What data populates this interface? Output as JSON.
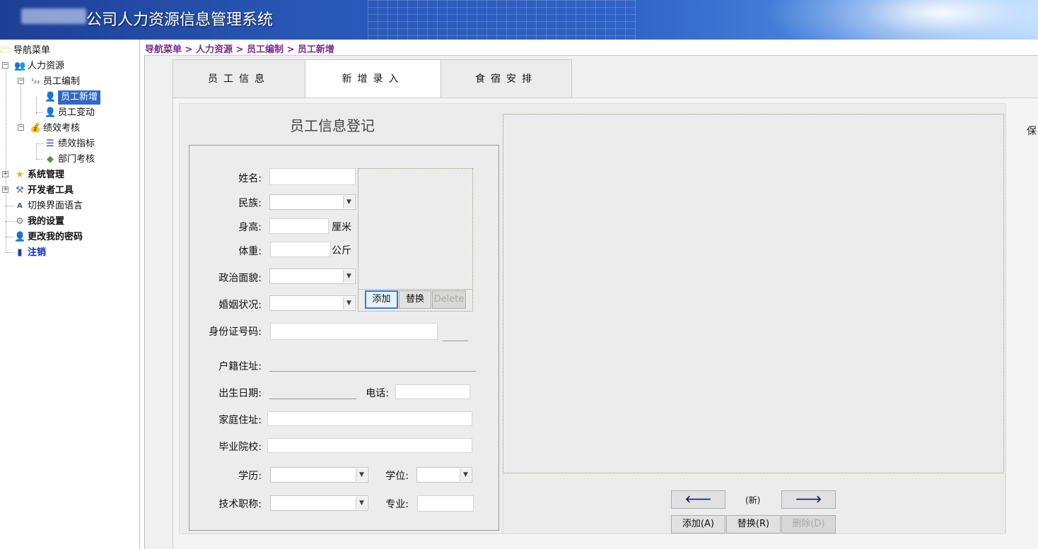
{
  "header": {
    "title": "公司人力资源信息管理系统"
  },
  "nav": {
    "root": "导航菜单",
    "items": [
      {
        "label": "人力资源"
      },
      {
        "label": "员工编制"
      },
      {
        "label": "员工新增"
      },
      {
        "label": "员工变动"
      },
      {
        "label": "绩效考核"
      },
      {
        "label": "绩效指标"
      },
      {
        "label": "部门考核"
      },
      {
        "label": "系统管理"
      },
      {
        "label": "开发者工具"
      },
      {
        "label": "切换界面语言"
      },
      {
        "label": "我的设置"
      },
      {
        "label": "更改我的密码"
      },
      {
        "label": "注销"
      }
    ],
    "num_icon_text": "¹₂₃"
  },
  "breadcrumb": {
    "sep": " > ",
    "parts": [
      "导航菜单",
      "人力资源",
      "员工编制",
      "员工新增"
    ]
  },
  "tabs": [
    "员工信息",
    "新增录入",
    "食宿安排"
  ],
  "form": {
    "title": "员工信息登记",
    "name_label": "姓名:",
    "ethnicity_label": "民族:",
    "height_label": "身高:",
    "height_unit": "厘米",
    "weight_label": "体重:",
    "weight_unit": "公斤",
    "political_label": "政治面貌:",
    "marital_label": "婚姻状况:",
    "idcard_label": "身份证号码:",
    "domicile_label": "户籍住址:",
    "birth_label": "出生日期:",
    "phone_label": "电话:",
    "home_label": "家庭住址:",
    "school_label": "毕业院校:",
    "education_label": "学历:",
    "degree_label": "学位:",
    "title_label": "技术职称:",
    "major_label": "专业:"
  },
  "photo": {
    "add": "添加",
    "replace": "替换",
    "delete": "Delete"
  },
  "preview": {
    "prev_arrow": "🡐",
    "next_arrow": "🡒",
    "status": "(新)",
    "add": "添加(A)",
    "replace": "替换(R)",
    "delete": "删除(D)"
  },
  "save_text": "保"
}
